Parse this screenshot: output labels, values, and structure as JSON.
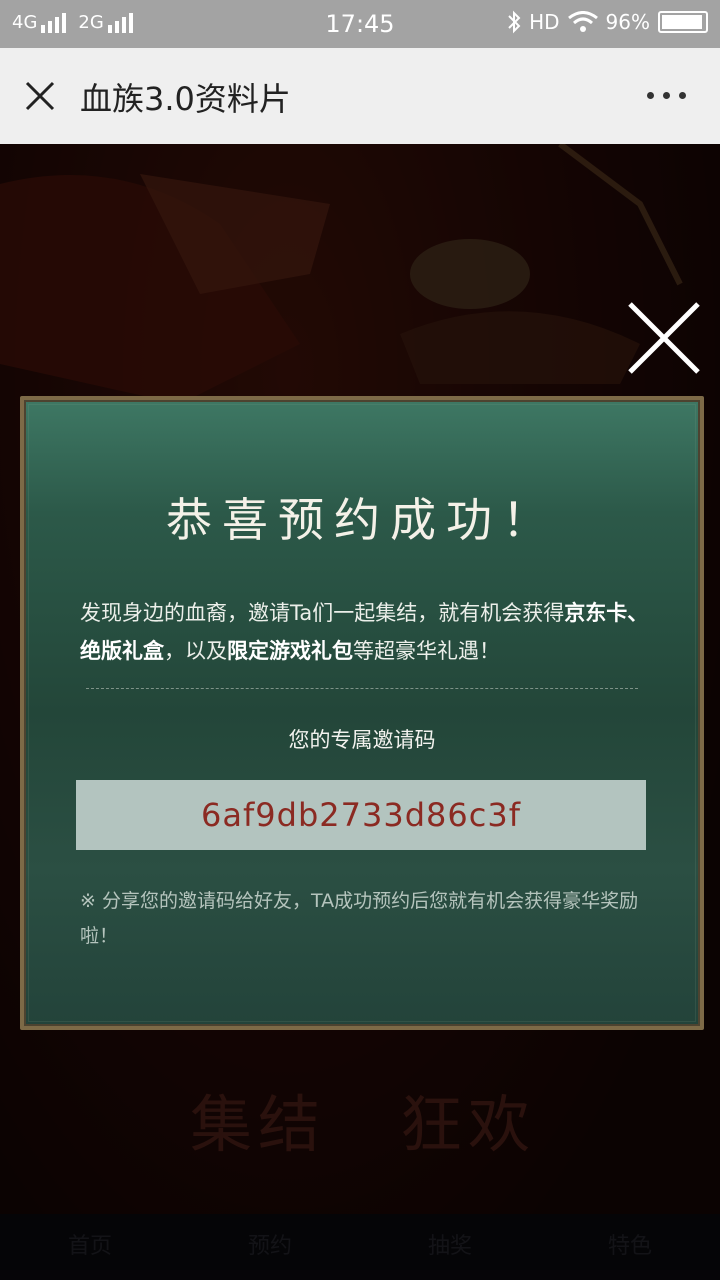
{
  "status_bar": {
    "signal1": "4G",
    "signal2": "2G",
    "time": "17:45",
    "hd": "HD",
    "battery": "96%",
    "battery_level": 0.96
  },
  "header": {
    "title": "血族3.0资料片"
  },
  "background": {
    "event_title_1": "集结",
    "event_title_2": "狂欢",
    "nav": [
      "首页",
      "预约",
      "抽奖",
      "特色"
    ]
  },
  "modal": {
    "title": "恭喜预约成功！",
    "desc_part1": "发现身边的血裔，邀请Ta们一起集结，就有机会获得",
    "desc_bold1": "京东卡、绝版礼盒",
    "desc_part2": "，以及",
    "desc_bold2": "限定游戏礼包",
    "desc_part3": "等超豪华礼遇！",
    "code_label": "您的专属邀请码",
    "invite_code": "6af9db2733d86c3f",
    "share_note": "※ 分享您的邀请码给好友，TA成功预约后您就有机会获得豪华奖励啦！"
  },
  "colors": {
    "modal_bg": "#2b4f43",
    "code_text": "#8b2a22",
    "code_box": "#b3c4bf",
    "header_bg": "#efefef"
  },
  "icons": [
    "close-icon",
    "more-icon",
    "modal-close-icon",
    "bluetooth-icon",
    "wifi-icon",
    "battery-icon"
  ]
}
